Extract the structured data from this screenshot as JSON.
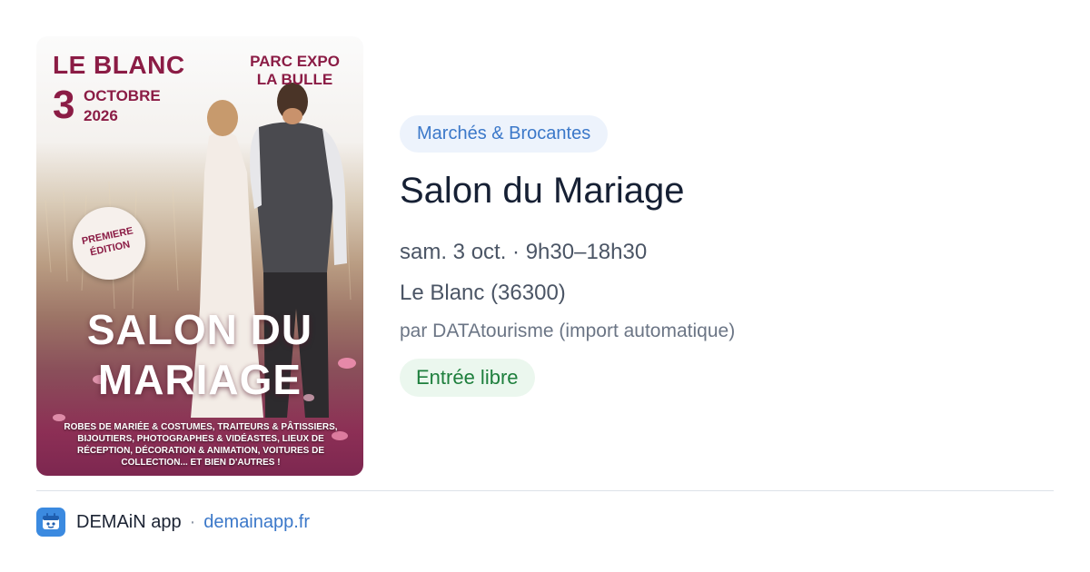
{
  "poster": {
    "city": "LE BLANC",
    "day": "3",
    "month": "OCTOBRE",
    "year": "2026",
    "venue": "PARC EXPO LA BULLE",
    "badge": "PREMIERE ÉDITION",
    "title": "SALON DU MARIAGE",
    "description": "ROBES DE MARIÉE & COSTUMES, TRAITEURS & PÂTISSIERS, BIJOUTIERS, PHOTOGRAPHES & VIDÉASTES, LIEUX DE RÉCEPTION, DÉCORATION & ANIMATION,   VOITURES DE COLLECTION... ET BIEN D'AUTRES !"
  },
  "event": {
    "category": "Marchés & Brocantes",
    "title": "Salon du Mariage",
    "datetime": "sam. 3 oct. · 9h30–18h30",
    "location": "Le Blanc (36300)",
    "source": "par DATAtourisme (import automatique)",
    "price": "Entrée libre"
  },
  "footer": {
    "app_name": "DEMAiN app",
    "separator": "·",
    "domain": "demainapp.fr"
  },
  "colors": {
    "accent": "#3b78c9",
    "category_bg": "#edf3fc",
    "price_text": "#1e7f3d",
    "price_bg": "#ebf7ee",
    "poster_text": "#8b1c45"
  },
  "icons": {
    "app": "app-logo-icon"
  }
}
